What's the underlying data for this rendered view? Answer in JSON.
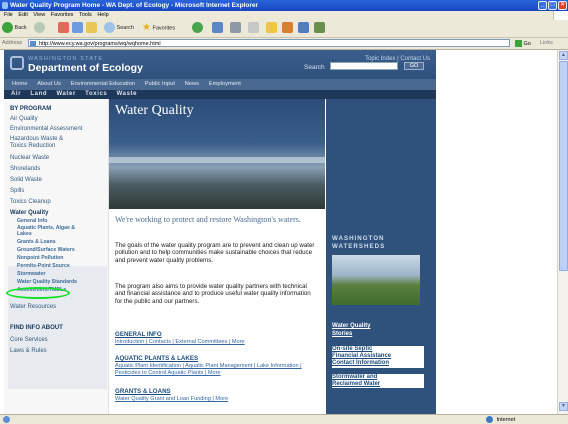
{
  "window": {
    "title": "Water Quality Program Home - WA Dept. of Ecology - Microsoft Internet Explorer",
    "menu": [
      "File",
      "Edit",
      "View",
      "Favorites",
      "Tools",
      "Help"
    ],
    "toolbar": {
      "back": "Back",
      "search": "Search",
      "favorites": "Favorites"
    },
    "address_label": "Address",
    "address_url": "http://www.ecy.wa.gov/programs/wq/wqhome.html",
    "go_label": "Go",
    "links_label": "Links",
    "status_zone": "Internet"
  },
  "header": {
    "state_label": "WASHINGTON STATE",
    "dept_name": "Department of Ecology",
    "top_links": "Topic Index | Contact Us",
    "search_label": "Search",
    "go_label": "GO"
  },
  "nav_main": [
    "Home",
    "About Us",
    "Environmental Education",
    "Public Input",
    "News",
    "Employment"
  ],
  "nav_sub": [
    "Air",
    "Land",
    "Water",
    "Toxics",
    "Waste"
  ],
  "left_nav": {
    "by_program": "BY PROGRAM",
    "programs": [
      "Air Quality",
      "Environmental Assessment",
      "Hazardous Waste &",
      "Toxics Reduction",
      "Nuclear Waste",
      "Shorelands",
      "Solid Waste",
      "Spills",
      "Toxics Cleanup"
    ],
    "water_quality": "Water Quality",
    "sub_items": [
      "General Info",
      "Aquatic Plants, Algae &",
      "Lakes",
      "Grants & Loans",
      "Ground/Surface Waters",
      "Nonpoint Pollution",
      "Permits-Point Source",
      "Stormwater",
      "Water Quality Standards",
      "Assessment/TMDLs"
    ],
    "water_resources": "Water Resources",
    "find_info": "FIND INFO ABOUT",
    "core_services": "Core Services",
    "laws_rules": "Laws & Rules"
  },
  "main": {
    "page_title": "Water Quality",
    "tagline": "We're working to protect and restore Washington's waters.",
    "para1": "The goals of the water quality program are to prevent and clean up water pollution and to help communities make sustainable choices that reduce and prevent water quality problems.",
    "para2": "The program also aims to provide water quality partners with technical and financial assistance and to produce useful water quality information for the public and our partners.",
    "sections": [
      {
        "head": "GENERAL INFO",
        "links": "Introduction | Contacts | External Committees | More"
      },
      {
        "head": "AQUATIC PLANTS & LAKES",
        "links": "Aquatic Plant Identification | Aquatic Plant Management | Lake Information | Pesticides to Control Aquatic Plants | More"
      },
      {
        "head": "GRANTS & LOANS",
        "links": "Water Quality Grant and Loan Funding | More"
      }
    ]
  },
  "right": {
    "watersheds_line1": "WASHINGTON",
    "watersheds_line2": "WATERSHEDS",
    "stories_line1": "Water Quality",
    "stories_line2": "Stories",
    "septic_line1": "On-site Septic",
    "septic_line2": "Financial Assistance",
    "septic_line3": "Contact Information",
    "storm_line1": "Stormwater and",
    "storm_line2": "Reclaimed Water"
  }
}
